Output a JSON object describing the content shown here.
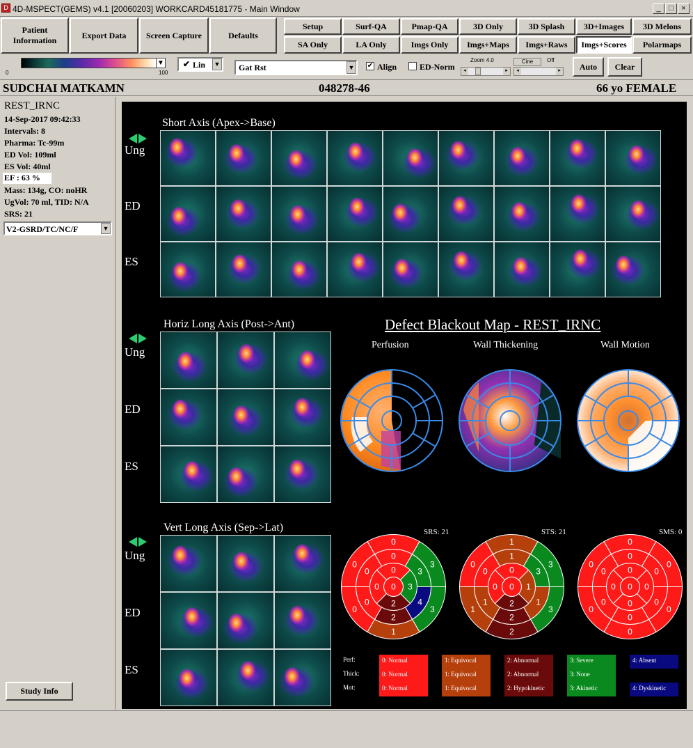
{
  "window": {
    "title": "4D-MSPECT(GEMS) v4.1 [20060203] WORKCARD45181775 - Main Window"
  },
  "toolbar": {
    "patient_info": "Patient Information",
    "export_data": "Export Data",
    "screen_capture": "Screen Capture",
    "defaults": "Defaults",
    "views_row1": [
      "Setup",
      "Surf-QA",
      "Pmap-QA",
      "3D Only",
      "3D Splash",
      "3D+Images",
      "3D Melons"
    ],
    "views_row2": [
      "SA Only",
      "LA Only",
      "Imgs Only",
      "Imgs+Maps",
      "Imgs+Raws",
      "Imgs+Scores",
      "Polarmaps"
    ],
    "selected_view": "Imgs+Scores"
  },
  "controls": {
    "cbar_min": "0",
    "cbar_max": "100",
    "scale_mode": "Lin",
    "dataset": "Gat Rst",
    "align_label": "Align",
    "ednorm_label": "ED-Norm",
    "zoom_label": "Zoom",
    "zoom_value": "4.0",
    "cine_label": "Cine",
    "off_label": "Off",
    "auto_label": "Auto",
    "clear_label": "Clear"
  },
  "patient": {
    "name": "SUDCHAI MATKAMN",
    "id": "048278-46",
    "age_sex": "66 yo FEMALE"
  },
  "study": {
    "name": "REST_IRNC",
    "date": "14-Sep-2017 09:42:33",
    "intervals": "Intervals: 8",
    "pharma": "Pharma: Tc-99m",
    "ed_vol": "ED Vol:   109ml",
    "es_vol": "ES Vol:    40ml",
    "ef": "EF   : 63 %",
    "mass": "Mass: 134g, CO: noHR",
    "ugvol": "UgVol:    70 ml,   TID: N/A",
    "srs": "SRS: 21",
    "model": "V2-GSRD/TC/NC/F",
    "study_info_btn": "Study Info"
  },
  "images": {
    "sa_title": "Short Axis (Apex->Base)",
    "hla_title": "Horiz Long Axis (Post->Ant)",
    "vla_title": "Vert Long Axis (Sep->Lat)",
    "row_labels": [
      "Ung",
      "ED",
      "ES"
    ]
  },
  "maps": {
    "title": "Defect Blackout Map - REST_IRNC",
    "perfusion": "Perfusion",
    "wall_thickening": "Wall Thickening",
    "wall_motion": "Wall Motion",
    "srs": "SRS: 21",
    "sts": "STS: 21",
    "sms": "SMS: 0",
    "perf_scores": {
      "apex": "0",
      "mid_in": [
        "0",
        "3",
        "2",
        "0"
      ],
      "r2": [
        "0",
        "3",
        "2",
        "0",
        "0",
        "0"
      ],
      "r3": [
        "0",
        "3",
        "4",
        "2",
        "0",
        "0"
      ],
      "r4": [
        "0",
        "3",
        "3",
        "1",
        "0",
        "0"
      ]
    },
    "thick_scores": {
      "apex": "0",
      "r2": [
        "0",
        "1",
        "2",
        "0",
        "0",
        "0"
      ],
      "r3": [
        "1",
        "3",
        "1",
        "2",
        "1",
        "0"
      ],
      "r4": [
        "1",
        "3",
        "3",
        "2",
        "1",
        "0"
      ]
    },
    "motion_scores": {
      "all": "0"
    }
  },
  "legend": {
    "rows": [
      "Perf:",
      "Thick:",
      "Mot:"
    ],
    "perf": [
      "0: Normal",
      "1: Equivocal",
      "2: Abnormal",
      "3: Severe",
      "4: Absent"
    ],
    "thick": [
      "0: Normal",
      "1: Equivocal",
      "2: Abnormal",
      "3: None"
    ],
    "mot": [
      "0: Normal",
      "1: Equivocal",
      "2: Hypokinetic",
      "3: Akinetic",
      "4: Dyskinetic"
    ],
    "colors": [
      "#ff1a1a",
      "#b5400c",
      "#6b0a0a",
      "#0a8a1e",
      "#0a0a80"
    ]
  }
}
